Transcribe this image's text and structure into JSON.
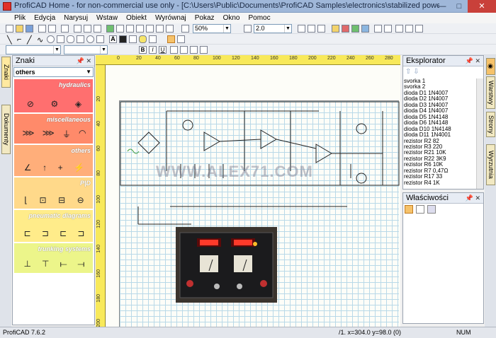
{
  "window": {
    "title": "ProfiCAD Home - for non-commercial use only - [C:\\Users\\Public\\Documents\\ProfiCAD Samples\\electronics\\stabilized power supply.sxe]",
    "minimize": "—",
    "maximize": "□",
    "close": "✕"
  },
  "menu": [
    "Plik",
    "Edycja",
    "Narysuj",
    "Wstaw",
    "Obiekt",
    "Wyrównaj",
    "Pokaz",
    "Okno",
    "Pomoc"
  ],
  "toolbar": {
    "zoom": "50%",
    "line_width": "2.0"
  },
  "left_tabs": [
    "Znaki",
    "Dokumenty"
  ],
  "znaki": {
    "title": "Znaki",
    "pin": "📌 ✕",
    "category": "others",
    "groups": [
      {
        "label": "hydraulics",
        "color": "#ff6f6f",
        "symbols": [
          "⊘",
          "⚙",
          "◈"
        ]
      },
      {
        "label": "miscellaneous",
        "color": "#ff8a6a",
        "symbols": [
          "⋙",
          "⋙",
          "⏚",
          "◠"
        ]
      },
      {
        "label": "others",
        "color": "#ffae7a",
        "symbols": [
          "∠",
          "↑",
          "+",
          "⚡"
        ]
      },
      {
        "label": "P|D",
        "color": "#ffd98a",
        "symbols": [
          "⌊",
          "⊡",
          "⊟",
          "⊖"
        ]
      },
      {
        "label": "pneumatic diagrams",
        "color": "#ffec8a",
        "symbols": [
          "⊏",
          "⊐",
          "⊏",
          "⊐"
        ]
      },
      {
        "label": "trunking systems",
        "color": "#ecf58a",
        "symbols": [
          "⊥",
          "⊤",
          "⟝",
          "⟞"
        ]
      }
    ]
  },
  "ruler_top": [
    "0",
    "20",
    "40",
    "60",
    "80",
    "100",
    "120",
    "140",
    "160",
    "180",
    "200",
    "220",
    "240",
    "260",
    "280"
  ],
  "ruler_left": [
    "20",
    "40",
    "60",
    "80",
    "100",
    "120",
    "140",
    "160",
    "180",
    "200"
  ],
  "watermark": "WWW.ALEX71.COM",
  "explorer": {
    "title": "Eksplorator",
    "pin": "📌 ✕",
    "items": [
      "svorka 1",
      "svorka 2",
      "dioda D1 1N4007",
      "dioda D2 1N4007",
      "dioda D3 1N4007",
      "dioda D4 1N4007",
      "dioda D5 1N4148",
      "dioda D6 1N4148",
      "dioda D10 1N4148",
      "dioda D11 1N4001",
      "rezistor R2 82",
      "rezistor R3 220",
      "rezistor R21 10K",
      "rezistor R22 3K9",
      "rezistor R6 10K",
      "rezistor R7 0,47Ω",
      "rezistor R17 33",
      "rezistor R4 1K"
    ]
  },
  "props": {
    "title": "Właściwości",
    "pin": "📌 ✕"
  },
  "right_tabs": [
    "Warstwy",
    "Strony",
    "Wyrzutnia"
  ],
  "status": {
    "version": "ProfiCAD 7.6.2",
    "coords": "/1.  x=304.0  y=98.0 (0)",
    "num": "NUM"
  }
}
